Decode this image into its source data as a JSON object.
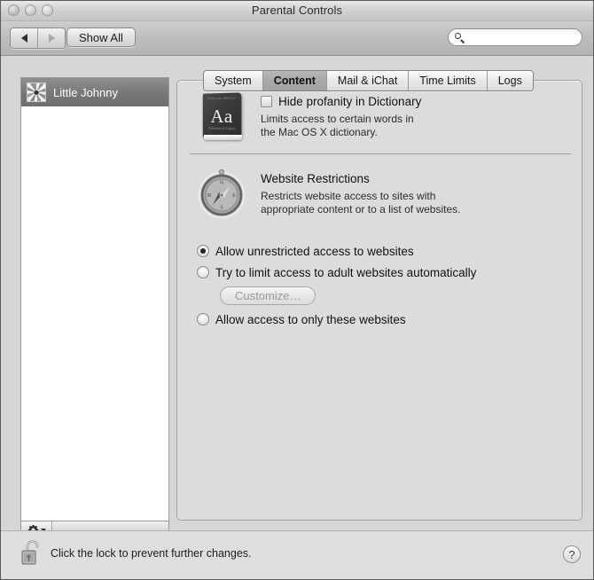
{
  "window": {
    "title": "Parental Controls",
    "traffic_lights": [
      "close",
      "minimize",
      "zoom"
    ]
  },
  "toolbar": {
    "back_label": "◀",
    "forward_label": "▶",
    "show_all_label": "Show All",
    "search": {
      "value": "",
      "placeholder": "",
      "icon": "search-icon"
    }
  },
  "sidebar": {
    "users": [
      {
        "name": "Little Johnny",
        "selected": true,
        "avatar": "flower-avatar"
      }
    ],
    "action_button": {
      "icon": "gear-icon",
      "menu_indicator": "chevron-down-icon"
    }
  },
  "tabs": [
    {
      "label": "System",
      "selected": false
    },
    {
      "label": "Content",
      "selected": true
    },
    {
      "label": "Mail & iChat",
      "selected": false
    },
    {
      "label": "Time Limits",
      "selected": false
    },
    {
      "label": "Logs",
      "selected": false
    }
  ],
  "content": {
    "dictionary": {
      "icon": "dictionary-book-icon",
      "icon_text": "Aa",
      "icon_top_text": "American Webster",
      "icon_bottom_text": "Dictionary of English",
      "checkbox_label": "Hide profanity in Dictionary",
      "checked": false,
      "description_line1": "Limits access to certain words in",
      "description_line2": "the Mac OS X dictionary."
    },
    "website_restrictions": {
      "icon": "safari-compass-icon",
      "title": "Website Restrictions",
      "description_line1": "Restricts website access to sites with",
      "description_line2": "appropriate content or to a list of websites.",
      "options": [
        {
          "label": "Allow unrestricted access to websites",
          "selected": true
        },
        {
          "label": "Try to limit access to adult websites automatically",
          "selected": false
        },
        {
          "label": "Allow access to only these websites",
          "selected": false
        }
      ],
      "customize_button": {
        "label": "Customize…",
        "enabled": false
      }
    }
  },
  "footer": {
    "lock_icon": "unlocked-padlock-icon",
    "lock_text": "Click the lock to prevent further changes.",
    "help_label": "?"
  },
  "colors": {
    "window_bg": "#d6d6d6",
    "panel_bg": "#dcdcdc",
    "selection": "#777777",
    "footer_bg": "#dededd"
  }
}
